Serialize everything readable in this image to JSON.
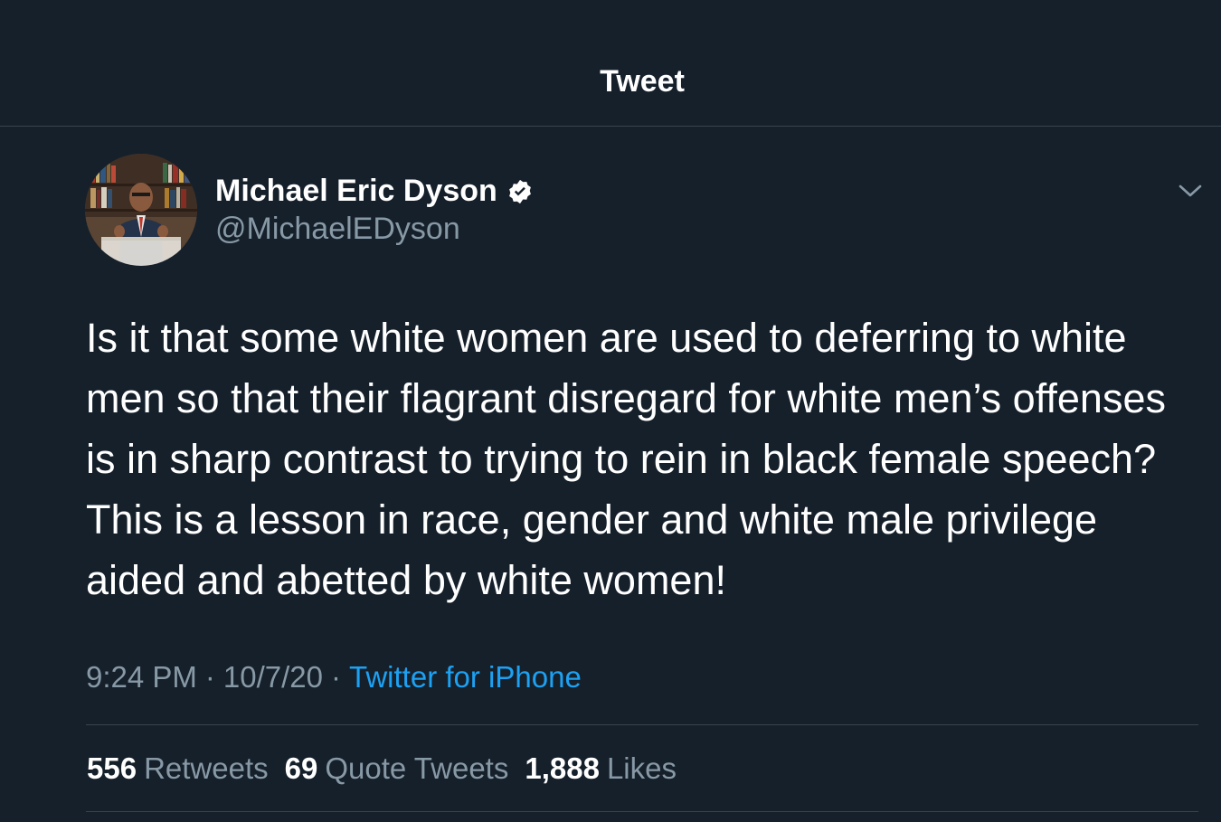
{
  "header": {
    "title": "Tweet"
  },
  "author": {
    "name": "Michael Eric Dyson",
    "handle": "@MichaelEDyson",
    "verified": true
  },
  "tweet": {
    "text": "Is it that some white women are used to deferring to white\nmen so that their flagrant disregard for white men’s offenses\nis in sharp contrast to trying to rein in black female speech?\nThis is a lesson in race, gender and white male privilege\naided and abetted by white women!",
    "time": "9:24 PM",
    "date": "10/7/20",
    "separator": "·",
    "source": "Twitter for iPhone"
  },
  "stats": [
    {
      "count": "556",
      "label": "Retweets"
    },
    {
      "count": "69",
      "label": "Quote Tweets"
    },
    {
      "count": "1,888",
      "label": "Likes"
    }
  ],
  "colors": {
    "background": "#15202b",
    "secondary_text": "#8899a6",
    "accent": "#1da1f2",
    "divider": "#38444d"
  },
  "icons": {
    "verified": "verified-badge-icon",
    "more": "chevron-down-icon"
  }
}
